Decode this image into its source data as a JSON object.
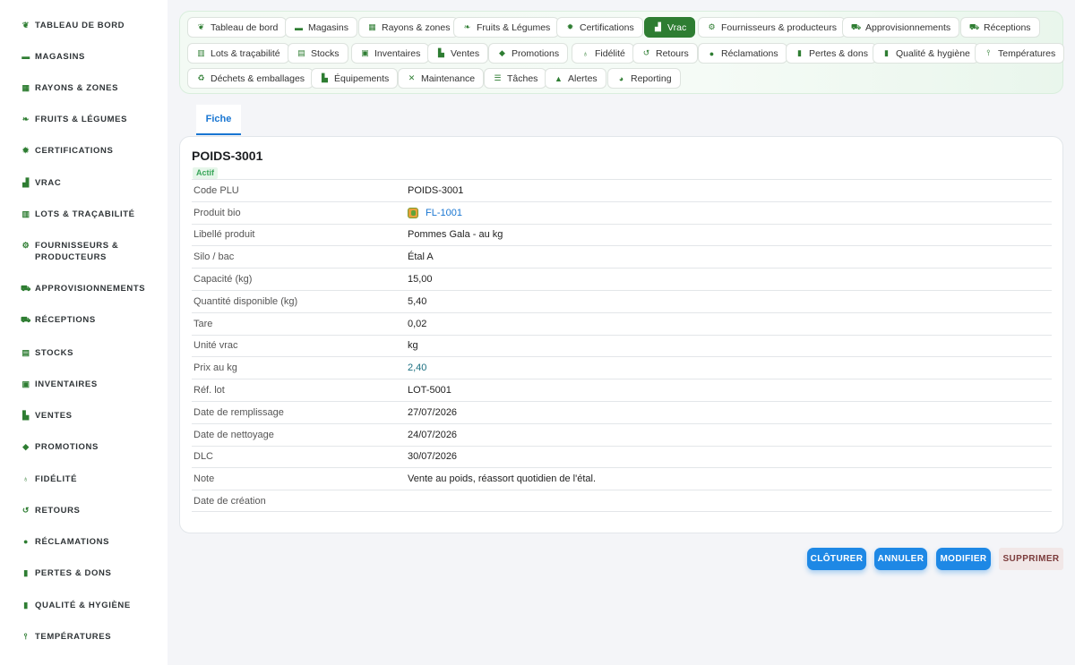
{
  "sidebar": {
    "items": [
      {
        "label": "TABLEAU DE BORD",
        "icon": "sprout-icon"
      },
      {
        "label": "MAGASINS",
        "icon": "store-icon"
      },
      {
        "label": "RAYONS & ZONES",
        "icon": "grid-icon"
      },
      {
        "label": "FRUITS & LÉGUMES",
        "icon": "leaf-icon"
      },
      {
        "label": "CERTIFICATIONS",
        "icon": "badge-icon"
      },
      {
        "label": "VRAC",
        "icon": "boxes-icon"
      },
      {
        "label": "LOTS & TRAÇABILITÉ",
        "icon": "barcode-icon"
      },
      {
        "label": "FOURNISSEURS & PRODUCTEURS",
        "icon": "tractor-icon"
      },
      {
        "label": "APPROVISIONNEMENTS",
        "icon": "cart-icon"
      },
      {
        "label": "RÉCEPTIONS",
        "icon": "truck-icon"
      },
      {
        "label": "STOCKS",
        "icon": "warehouse-icon"
      },
      {
        "label": "INVENTAIRES",
        "icon": "clipboard-check-icon"
      },
      {
        "label": "VENTES",
        "icon": "cash-register-icon"
      },
      {
        "label": "PROMOTIONS",
        "icon": "tag-icon"
      },
      {
        "label": "FIDÉLITÉ",
        "icon": "award-icon"
      },
      {
        "label": "RETOURS",
        "icon": "undo-icon"
      },
      {
        "label": "RÉCLAMATIONS",
        "icon": "chat-icon"
      },
      {
        "label": "PERTES & DONS",
        "icon": "trash-icon"
      },
      {
        "label": "QUALITÉ & HYGIÈNE",
        "icon": "clipboard-icon"
      },
      {
        "label": "TEMPÉRATURES",
        "icon": "thermometer-icon"
      }
    ]
  },
  "nav": {
    "chips": [
      {
        "label": "Tableau de bord",
        "icon": "sprout-icon"
      },
      {
        "label": "Magasins",
        "icon": "store-icon"
      },
      {
        "label": "Rayons & zones",
        "icon": "grid-icon"
      },
      {
        "label": "Fruits & Légumes",
        "icon": "leaf-icon"
      },
      {
        "label": "Certifications",
        "icon": "badge-icon"
      },
      {
        "label": "Vrac",
        "icon": "boxes-icon",
        "active": true
      },
      {
        "label": "Fournisseurs & producteurs",
        "icon": "tractor-icon"
      },
      {
        "label": "Approvisionnements",
        "icon": "cart-icon"
      },
      {
        "label": "Réceptions",
        "icon": "truck-icon"
      },
      {
        "label": "Lots & traçabilité",
        "icon": "barcode-icon"
      },
      {
        "label": "Stocks",
        "icon": "warehouse-icon"
      },
      {
        "label": "Inventaires",
        "icon": "clipboard-check-icon"
      },
      {
        "label": "Ventes",
        "icon": "cash-register-icon"
      },
      {
        "label": "Promotions",
        "icon": "tag-icon"
      },
      {
        "label": "Fidélité",
        "icon": "award-icon"
      },
      {
        "label": "Retours",
        "icon": "undo-icon"
      },
      {
        "label": "Réclamations",
        "icon": "chat-icon"
      },
      {
        "label": "Pertes & dons",
        "icon": "trash-icon"
      },
      {
        "label": "Qualité & hygiène",
        "icon": "clipboard-icon"
      },
      {
        "label": "Températures",
        "icon": "thermometer-icon"
      },
      {
        "label": "Déchets & emballages",
        "icon": "recycle-icon"
      },
      {
        "label": "Équipements",
        "icon": "equipment-icon"
      },
      {
        "label": "Maintenance",
        "icon": "tools-icon"
      },
      {
        "label": "Tâches",
        "icon": "list-icon"
      },
      {
        "label": "Alertes",
        "icon": "bell-icon"
      },
      {
        "label": "Reporting",
        "icon": "pie-chart-icon"
      }
    ]
  },
  "tabs": [
    {
      "label": "Fiche"
    }
  ],
  "record": {
    "title": "POIDS-3001",
    "status": "Actif",
    "fields": [
      {
        "label": "Code PLU",
        "value": "POIDS-3001"
      },
      {
        "label": "Produit bio",
        "value": "FL-1001",
        "link": true,
        "icon": "fruit-icon"
      },
      {
        "label": "Libellé produit",
        "value": "Pommes Gala - au kg"
      },
      {
        "label": "Silo / bac",
        "value": "Étal A"
      },
      {
        "label": "Capacité (kg)",
        "value": "15,00"
      },
      {
        "label": "Quantité disponible (kg)",
        "value": "5,40"
      },
      {
        "label": "Tare",
        "value": "0,02"
      },
      {
        "label": "Unité vrac",
        "value": "kg"
      },
      {
        "label": "Prix au kg",
        "value": "2,40",
        "highlight": true
      },
      {
        "label": "Réf. lot",
        "value": "LOT-5001"
      },
      {
        "label": "Date de remplissage",
        "value": "27/07/2026"
      },
      {
        "label": "Date de nettoyage",
        "value": "24/07/2026"
      },
      {
        "label": "DLC",
        "value": "30/07/2026"
      },
      {
        "label": "Note",
        "value": "Vente au poids, réassort quotidien de l'étal."
      },
      {
        "label": "Date de création",
        "value": ""
      }
    ]
  },
  "actions": {
    "close": "CLÔTURER",
    "cancel": "ANNULER",
    "edit": "MODIFIER",
    "delete": "SUPPRIMER"
  },
  "colors": {
    "accent_green": "#2e7d32",
    "primary_blue": "#1e88e5",
    "link_blue": "#1976d2",
    "status_green": "#3aa65a"
  }
}
